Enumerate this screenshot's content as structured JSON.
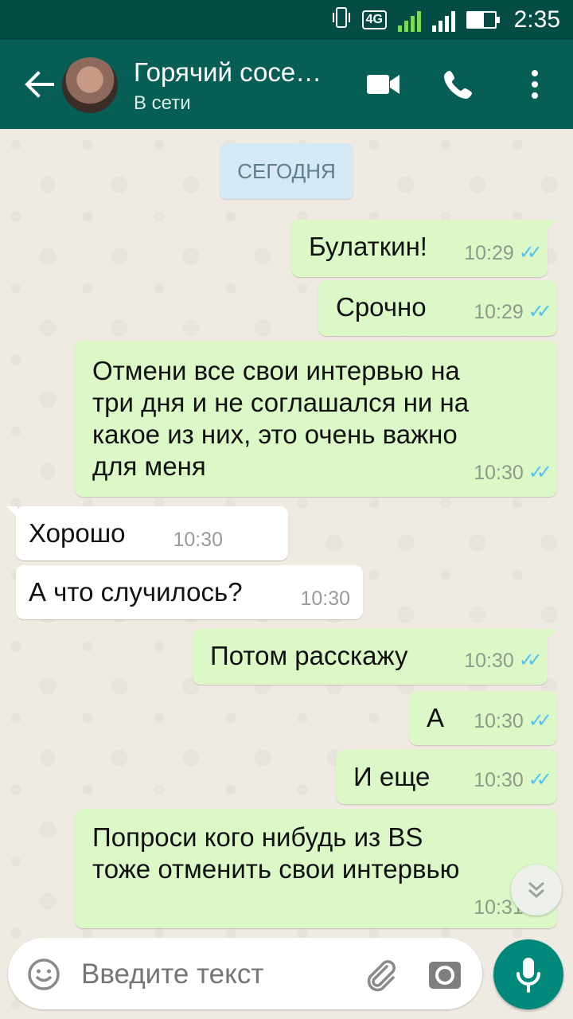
{
  "status_bar": {
    "network": "4G",
    "sim1": "1",
    "sim2": "2",
    "time": "2:35"
  },
  "header": {
    "contact_name": "Горячий сосе…",
    "contact_status": "В сети",
    "icons": [
      "back-arrow-icon",
      "video-call-icon",
      "phone-call-icon",
      "more-options-icon"
    ]
  },
  "chat": {
    "date_label": "СЕГОДНЯ",
    "messages": [
      {
        "direction": "out",
        "text": "Булаткин!",
        "time": "10:29",
        "status": "read"
      },
      {
        "direction": "out",
        "text": "Срочно",
        "time": "10:29",
        "status": "read"
      },
      {
        "direction": "out",
        "lines": [
          "Отмени все свои интервью на",
          "три дня и не соглашался ни на",
          "какое из них, это очень важно",
          "для меня"
        ],
        "time": "10:30",
        "status": "read"
      },
      {
        "direction": "in",
        "text": "Хорошо",
        "time": "10:30"
      },
      {
        "direction": "in",
        "text": "А что случилось?",
        "time": "10:30"
      },
      {
        "direction": "out",
        "text": "Потом расскажу",
        "time": "10:30",
        "status": "read"
      },
      {
        "direction": "out",
        "text": "А",
        "time": "10:30",
        "status": "read"
      },
      {
        "direction": "out",
        "text": "И еще",
        "time": "10:30",
        "status": "read"
      },
      {
        "direction": "out",
        "lines": [
          "Попроси кого нибудь из BS",
          "тоже отменить свои интервью"
        ],
        "time": "10:31",
        "status": "read"
      }
    ]
  },
  "composer": {
    "placeholder": "Введите текст"
  },
  "colors": {
    "header": "#075e54",
    "status_bar": "#054d44",
    "outgoing_bubble": "#dcf8c6",
    "incoming_bubble": "#ffffff",
    "read_ticks": "#4fc3f7",
    "mic_button": "#00897b"
  }
}
